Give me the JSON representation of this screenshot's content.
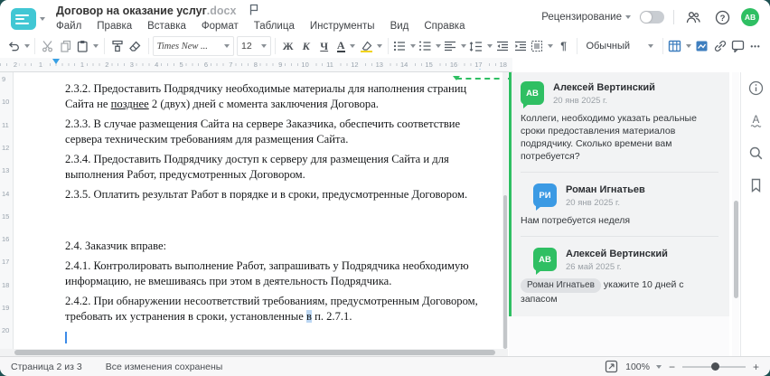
{
  "header": {
    "doc_title": "Договор на оказание услуг",
    "doc_ext": ".docx",
    "review_label": "Рецензирование",
    "avatar_initials": "АВ"
  },
  "menu": {
    "items": [
      "Файл",
      "Правка",
      "Вставка",
      "Формат",
      "Таблица",
      "Инструменты",
      "Вид",
      "Справка"
    ]
  },
  "toolbar": {
    "font_name": "Times New ...",
    "font_size": "12",
    "bold_label": "Ж",
    "italic_label": "К",
    "underline_label": "Ч",
    "font_color_label": "А",
    "paragraph_mark": "¶",
    "style_name": "Обычный",
    "more_label": "•••"
  },
  "ruler": {
    "h_pre": [
      {
        "label": "2",
        "x": 17
      },
      {
        "label": "1",
        "x": 45
      }
    ],
    "h_labels": [
      "1",
      "2",
      "3",
      "4",
      "5",
      "6",
      "7",
      "8",
      "9",
      "10",
      "11",
      "12",
      "13",
      "14",
      "15",
      "16",
      "17",
      "18"
    ],
    "h_start": 91,
    "h_step": 27.4,
    "v_labels": [
      "9",
      "10",
      "11",
      "12",
      "13",
      "14",
      "15",
      "16",
      "17",
      "18",
      "19",
      "20"
    ],
    "v_start": 3,
    "v_step": 25.3
  },
  "document": {
    "p232_pre": "2.3.2. Предоставить Подрядчику необходимые материалы для наполнения страниц Сайта не ",
    "p232_marked": "позднее",
    "p232_post": " 2 (двух) дней с момента заключения Договора.",
    "p233": "2.3.3. В случае размещения Сайта на сервере Заказчика, обеспечить соответствие сервера техническим требованиям для размещения Сайта.",
    "p234": "2.3.4. Предоставить Подрядчику доступ к серверу для размещения Сайта и для выполнения Работ, предусмотренных Договором.",
    "p235": "2.3.5. Оплатить результат Работ в порядке и в сроки, предусмотренные Договором.",
    "p24": "2.4. Заказчик вправе:",
    "p241": "2.4.1. Контролировать выполнение Работ, запрашивать у Подрядчика необходимую информацию, не вмешиваясь при этом в деятельность Подрядчика.",
    "p242_pre": "2.4.2. При обнаружении несоответствий требованиям, предусмотренным Договором, требовать их устранения в сроки, установленные ",
    "p242_marked": "в",
    "p242_post": " п. 2.7.1."
  },
  "comments": {
    "c1": {
      "initials": "АВ",
      "name": "Алексей Вертинский",
      "date": "20 янв 2025 г.",
      "text": "Коллеги, необходимо указать реальные сроки предоставления материалов подрядчику. Сколько времени вам потребуется?"
    },
    "c2": {
      "initials": "РИ",
      "name": "Роман Игнатьев",
      "date": "20 янв 2025 г.",
      "text": "Нам потребуется неделя"
    },
    "c3": {
      "initials": "АВ",
      "name": "Алексей Вертинский",
      "date": "26 май 2025 г.",
      "mention": "Роман Игнатьев",
      "text": "укажите 10 дней с запасом"
    }
  },
  "statusbar": {
    "page_info": "Страница 2 из 3",
    "save_status": "Все изменения сохранены",
    "zoom_value": "100%"
  },
  "colors": {
    "accent_teal": "#41c7d4",
    "comment_green": "#2fbf63",
    "comment_blue": "#3b9ae4",
    "toolbar_blue": "#3f7fbf",
    "marker_blue": "#38a0e4"
  }
}
